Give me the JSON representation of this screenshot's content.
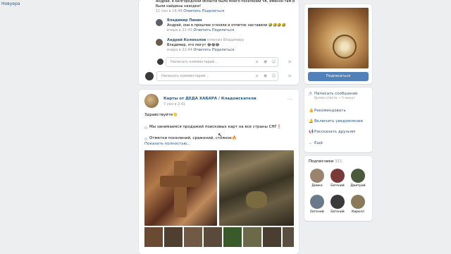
{
  "left_nav": {
    "link": "Новуера"
  },
  "comments": [
    {
      "name": "",
      "text": "Андрей, в Белгородской области было много поселений ЧК, именно там и были найдены находки!",
      "time": "11 сен в 14:48",
      "reply": "Ответить",
      "share": "Поделиться"
    },
    {
      "name": "Владимир Пинин",
      "text": "Андрей, они в прошлое сгоняли и отметок наставили 🤣🤣🤣🤣",
      "time": "вчера в 22:43",
      "reply": "Ответить",
      "share": "Поделиться"
    },
    {
      "name": "Андрей Колоколов",
      "reply_to": "ответил Владимиру",
      "text": "Владимир, это могут 😂😂😂",
      "time": "вчера в 22:44",
      "reply": "Ответить",
      "share": "Поделиться"
    }
  ],
  "inputs": {
    "reply_placeholder": "Написать комментарий...",
    "comment_placeholder": "Написать комментарий..."
  },
  "post": {
    "author": "Карты от ДЕДА ХАБАРА / Кладоискатели",
    "date": "7 сен в 2:41",
    "greeting": "Здравствуйте👋",
    "line1": "Мы занимаемся продажей поисковых карт на все страны СНГ❗",
    "line2": "Отметки поселений, сражений, стоянок🔥",
    "show_more": "Показать полностью..."
  },
  "sidebar": {
    "subscribe_label": "Подписаться",
    "message_label": "Написать сообщение",
    "message_sub": "Время ответа ~ 5 минут",
    "actions": [
      "Рекомендовать",
      "Включить уведомления",
      "Рассказать друзьям",
      "Ещё"
    ],
    "subscribers_title": "Подписчики",
    "subscribers_count": "321",
    "subscribers": [
      "Димка",
      "Евгений",
      "Дмитрий",
      "Евгений",
      "Евгений",
      "Кирилл"
    ]
  }
}
